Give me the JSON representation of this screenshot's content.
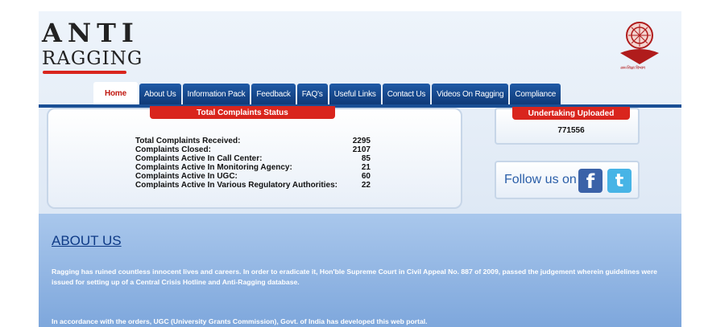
{
  "logo": {
    "line1": "ANTI",
    "line2": "RAGGING",
    "hindi_caption": "अन-शिक्षा विभाग"
  },
  "nav": {
    "tabs": [
      {
        "label": "Home",
        "active": true
      },
      {
        "label": "About Us"
      },
      {
        "label": "Information Pack"
      },
      {
        "label": "Feedback"
      },
      {
        "label": "FAQ's"
      },
      {
        "label": "Useful Links"
      },
      {
        "label": "Contact Us"
      },
      {
        "label": "Videos On Ragging"
      },
      {
        "label": "Compliance"
      }
    ]
  },
  "complaints": {
    "title": "Total Complaints Status",
    "rows": [
      {
        "label": "Total Complaints Received:",
        "value": "2295"
      },
      {
        "label": "Complaints Closed:",
        "value": "2107"
      },
      {
        "label": "Complaints Active In Call Center:",
        "value": "85"
      },
      {
        "label": "Complaints Active In Monitoring Agency:",
        "value": "21"
      },
      {
        "label": "Complaints Active In UGC:",
        "value": "60"
      },
      {
        "label": "Complaints Active In Various Regulatory Authorities:",
        "value": "22"
      }
    ]
  },
  "undertaking": {
    "title": "Undertaking Uploaded",
    "value": "771556"
  },
  "social": {
    "text": "Follow us on",
    "facebook": "f",
    "twitter": "t"
  },
  "about": {
    "heading": "ABOUT US",
    "p1": "Ragging has ruined countless innocent lives and careers. In order to eradicate it, Hon'ble Supreme Court in Civil Appeal No. 887 of 2009, passed the judgement wherein guidelines were issued for setting up of a Central Crisis Hotline and Anti-Ragging database.",
    "p2": "In accordance with the orders, UGC (University Grants Commission), Govt. of India has developed this web portal."
  },
  "colors": {
    "accent_red": "#d9251d",
    "nav_blue": "#1f5aa6",
    "about_blue": "#7ea7dc"
  }
}
